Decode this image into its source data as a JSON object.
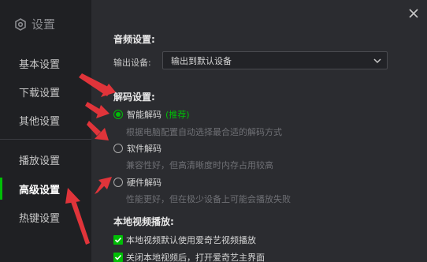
{
  "window": {
    "title": "设置"
  },
  "sidebar": {
    "items": [
      {
        "label": "基本设置"
      },
      {
        "label": "下载设置"
      },
      {
        "label": "其他设置"
      },
      {
        "label": "播放设置"
      },
      {
        "label": "高级设置",
        "active": true
      },
      {
        "label": "热键设置"
      }
    ]
  },
  "audio": {
    "title": "音频设置:",
    "output_label": "输出设备:",
    "output_value": "输出到默认设备"
  },
  "decode": {
    "title": "解码设置:",
    "options": [
      {
        "label": "智能解码",
        "badge": "(推荐)",
        "desc": "根据电脑配置自动选择最合适的解码方式",
        "selected": true
      },
      {
        "label": "软件解码",
        "desc": "兼容性好，但高清晰度时内存占用较高",
        "selected": false
      },
      {
        "label": "硬件解码",
        "desc": "性能更好，但在极少设备上可能会播放失败",
        "selected": false
      }
    ]
  },
  "local": {
    "title": "本地视频播放:",
    "options": [
      {
        "label": "本地视频默认使用爱奇艺视频播放",
        "checked": true
      },
      {
        "label": "关闭本地视频后，打开爱奇艺主界面",
        "checked": true
      }
    ]
  },
  "colors": {
    "accent": "#00be06",
    "annotation": "#e0343a"
  },
  "icons": {
    "title": "gear-icon",
    "close": "close-icon",
    "dropdown": "chevron-down-icon"
  }
}
